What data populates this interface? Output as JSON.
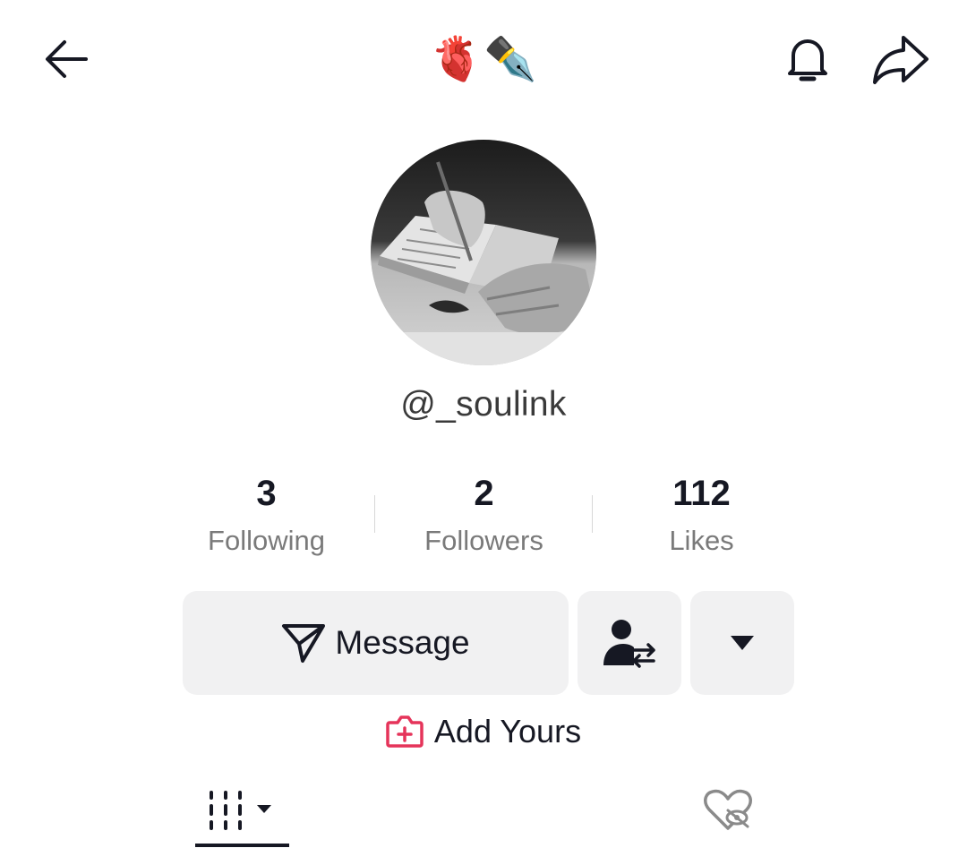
{
  "header": {
    "title_emoji": "🫀✒️",
    "back_icon": "arrow-left-icon",
    "bell_icon": "bell-icon",
    "share_icon": "share-arrow-icon"
  },
  "profile": {
    "avatar_description": "black-and-white photo of a hand writing in a notebook",
    "username": "@_soulink"
  },
  "stats": {
    "following": {
      "value": "3",
      "label": "Following"
    },
    "followers": {
      "value": "2",
      "label": "Followers"
    },
    "likes": {
      "value": "112",
      "label": "Likes"
    }
  },
  "actions": {
    "message_label": "Message",
    "message_icon": "send-icon",
    "follow_back_icon": "user-swap-icon",
    "more_icon": "caret-down-icon"
  },
  "add_yours": {
    "label": "Add Yours",
    "icon": "camera-plus-icon",
    "icon_color": "#e5345a"
  },
  "tabs": {
    "videos_icon": "grid-icon",
    "liked_icon": "hidden-heart-icon"
  },
  "colors": {
    "text_primary": "#161823",
    "text_secondary": "#7a7a7a",
    "button_bg": "#f1f1f2",
    "accent": "#e5345a"
  }
}
